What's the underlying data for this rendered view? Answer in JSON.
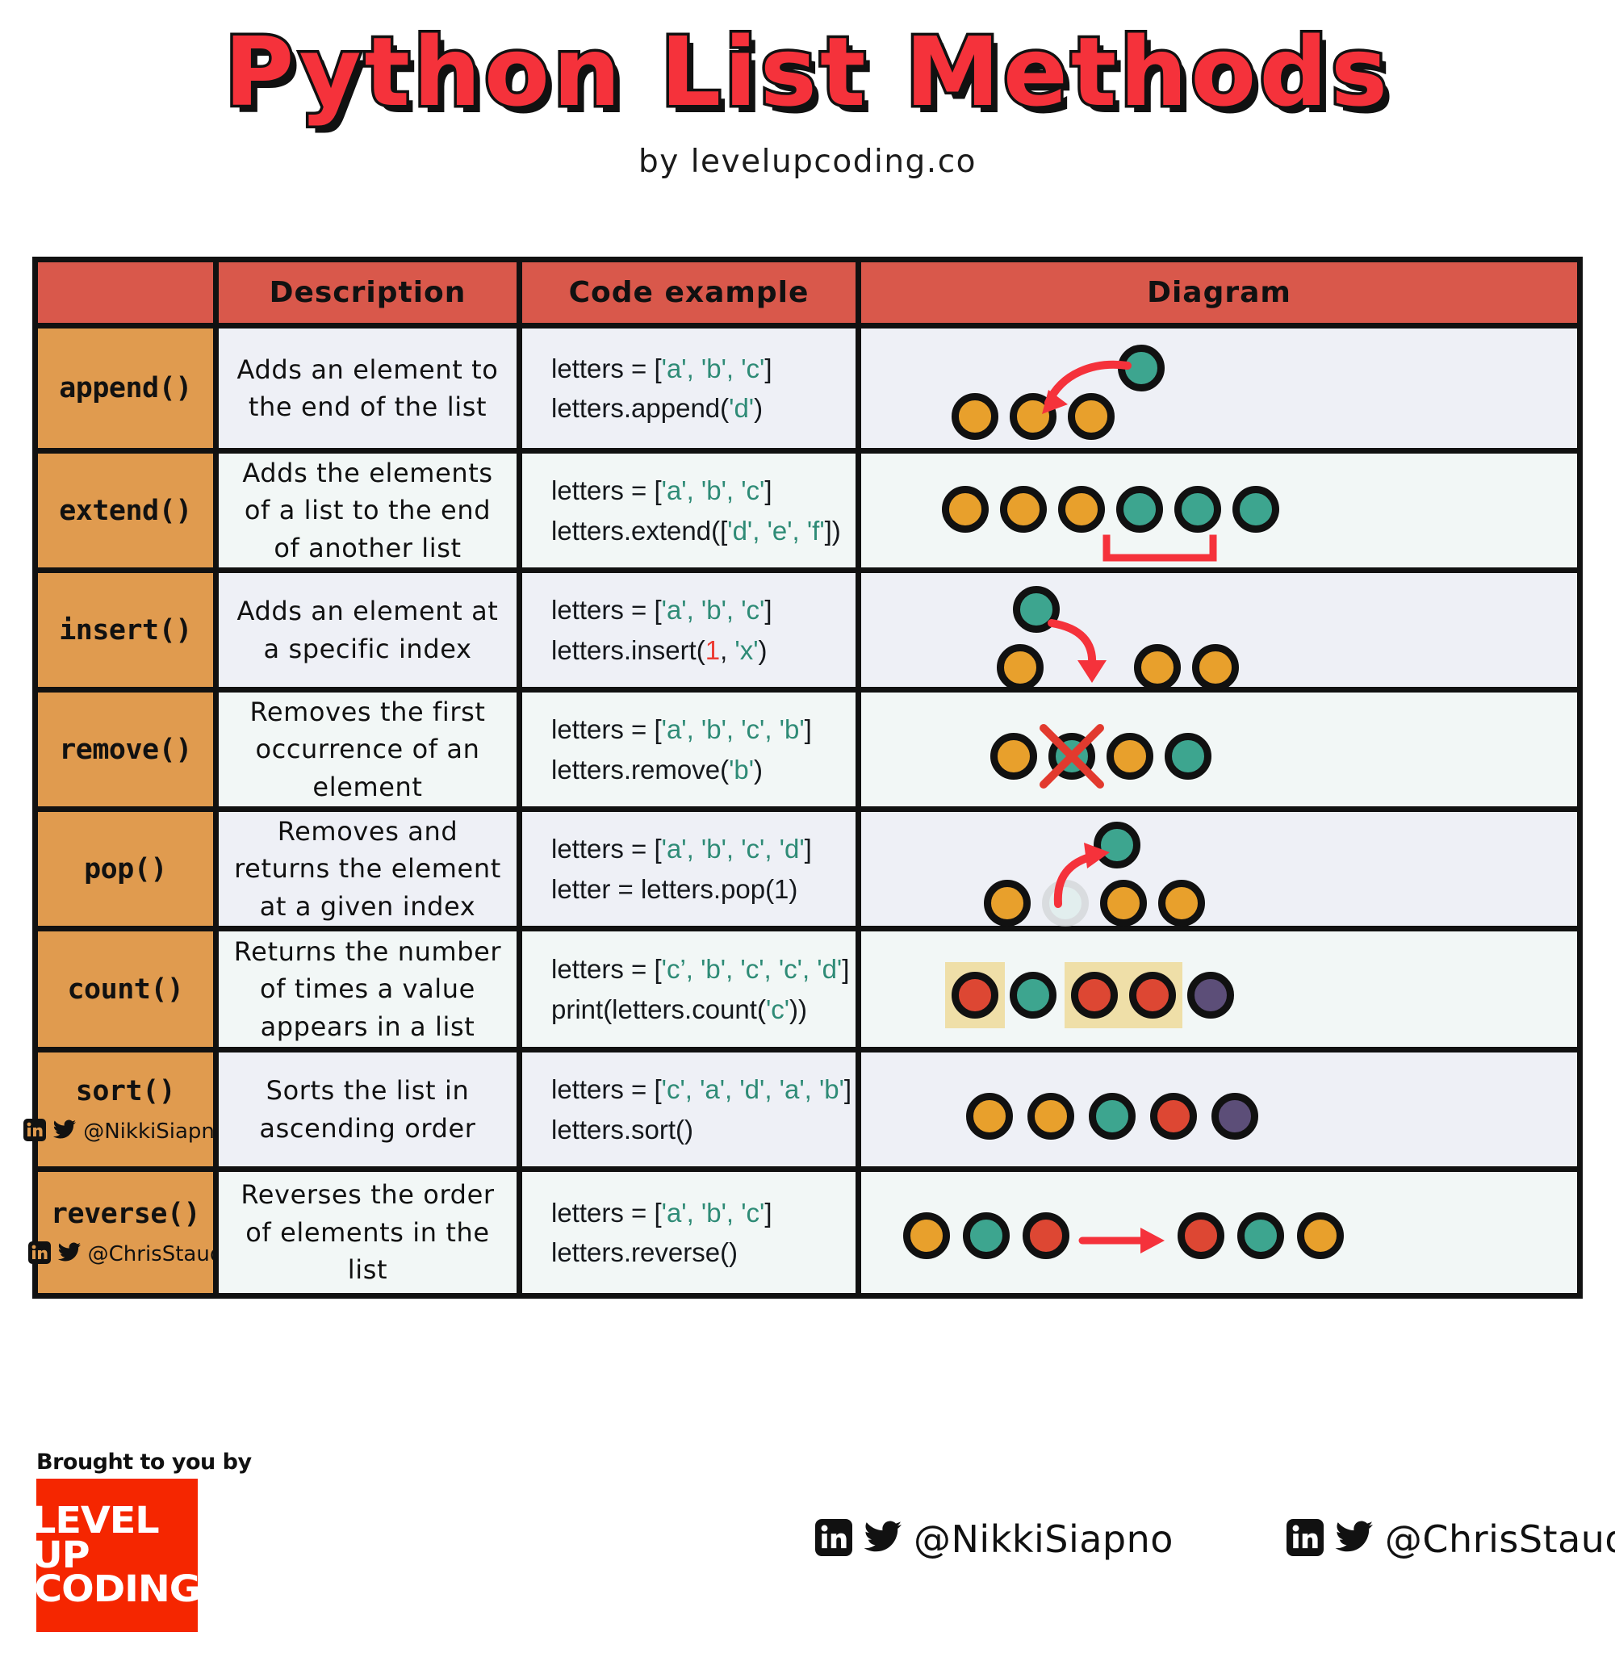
{
  "header": {
    "title": "Python List Methods",
    "byline": "by levelupcoding.co"
  },
  "colors": {
    "title_fill": "#F5323B",
    "header_row": "#D9584B",
    "method_col": "#E09B4F",
    "row_light": "#EEF0F6",
    "row_alt": "#F2F7F6",
    "dot_orange": "#E8A02C",
    "dot_teal": "#3DA58F",
    "dot_red": "#DD4733",
    "dot_purple": "#5C4E78",
    "highlight": "#EFDFA8",
    "arrow_red": "#F5323B",
    "string_literal": "#2E8B76",
    "number_literal": "#EC3B32",
    "logo_red": "#F52600"
  },
  "table": {
    "columns": [
      "",
      "Description",
      "Code example",
      "Diagram"
    ],
    "rows": [
      {
        "method": "append()",
        "description": "Adds an element to the end of the list",
        "code_line1_pre": "letters = [",
        "code_line1_items": "'a', 'b', 'c'",
        "code_line1_post": "]",
        "code_line2_pre": "letters.append(",
        "code_line2_arg": "'d'",
        "code_line2_post": ")",
        "diagram": "three orange dots, red curved arrow pointing left-down from a teal dot"
      },
      {
        "method": "extend()",
        "description": "Adds the elements of a list to the end of another list",
        "code_line1_pre": "letters = [",
        "code_line1_items": "'a', 'b', 'c'",
        "code_line1_post": "]",
        "code_line2_pre": "letters.extend([",
        "code_line2_arg": "'d', 'e', 'f'",
        "code_line2_post": "])",
        "diagram": "three orange dots then three teal dots with red bracket under the teal group"
      },
      {
        "method": "insert()",
        "description": "Adds an element at a specific index",
        "code_line1_pre": "letters = [",
        "code_line1_items": "'a', 'b', 'c'",
        "code_line1_post": "]",
        "code_line2_pre": "letters.insert(",
        "code_line2_num": "1",
        "code_line2_mid": ", ",
        "code_line2_arg": "'x'",
        "code_line2_post": ")",
        "diagram": "teal dot above, red curved arrow down into gap between orange dots"
      },
      {
        "method": "remove()",
        "description": "Removes the first occurrence of an element",
        "code_line1_pre": "letters = [",
        "code_line1_items": "'a', 'b', 'c', 'b'",
        "code_line1_post": "]",
        "code_line2_pre": "letters.remove(",
        "code_line2_arg": "'b'",
        "code_line2_post": ")",
        "diagram": "orange, teal crossed out with red X, orange, teal"
      },
      {
        "method": "pop()",
        "description": "Removes and returns the element at a given index",
        "code_line1_pre": "letters = [",
        "code_line1_items": "'a', 'b', 'c', 'd'",
        "code_line1_post": "]",
        "code_line2_pre": "letter = letters.pop(1)",
        "code_line2_arg": "",
        "code_line2_post": "",
        "diagram": "orange, faded ghost dot, orange, orange with red arrow up to a teal dot"
      },
      {
        "method": "count()",
        "description": "Returns the number of times a value appears in a list",
        "code_line1_pre": "letters = [",
        "code_line1_items": "'c’, 'b', 'c', 'c', 'd'",
        "code_line1_post": "]",
        "code_line2_pre": "print(letters.count(",
        "code_line2_arg": "'c'",
        "code_line2_post": "))",
        "diagram": "red(highlighted), teal, red+red(highlighted), purple"
      },
      {
        "method": "sort()",
        "handle": "@NikkiSiapno",
        "description": "Sorts the list in ascending order",
        "code_line1_pre": "letters = [",
        "code_line1_items": "'c', 'a', 'd', 'a', 'b'",
        "code_line1_post": "]",
        "code_line2_pre": "letters.sort()",
        "code_line2_arg": "",
        "code_line2_post": "",
        "diagram": "orange, orange, teal, red, purple"
      },
      {
        "method": "reverse()",
        "handle": "@ChrisStaud",
        "description": "Reverses the order of elements in the list",
        "code_line1_pre": "letters = [",
        "code_line1_items": "'a', 'b', 'c'",
        "code_line1_post": "]",
        "code_line2_pre": "letters.reverse()",
        "code_line2_arg": "",
        "code_line2_post": "",
        "diagram": "orange, teal, red then red arrow then red, teal, orange"
      }
    ]
  },
  "footer": {
    "brought_by": "Brought to you by",
    "logo_line1": "LEVEL UP",
    "logo_line2": "CODING",
    "handles": [
      "@NikkiSiapno",
      "@ChrisStaud"
    ]
  }
}
